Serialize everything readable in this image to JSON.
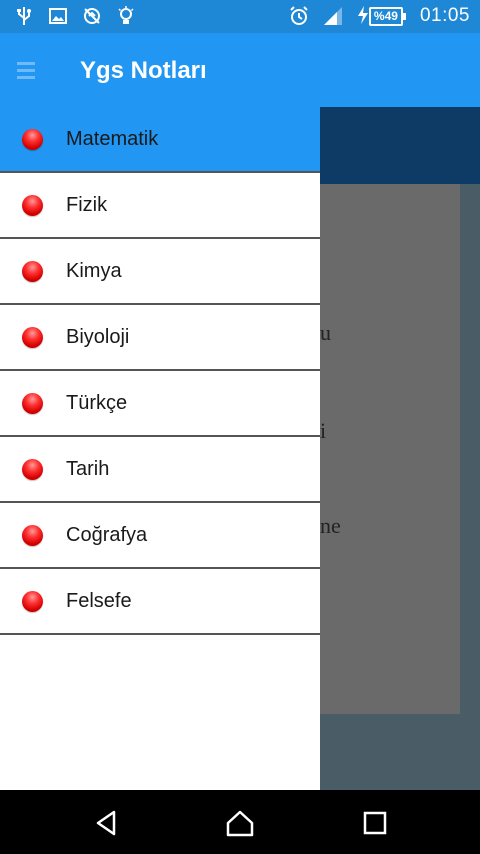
{
  "status_bar": {
    "time": "01:05",
    "battery": "%49",
    "icons": [
      "usb-icon",
      "image-icon",
      "no-sync-icon",
      "bulb-icon",
      "alarm-icon",
      "signal-icon",
      "charging-icon",
      "battery-icon"
    ]
  },
  "app_bar": {
    "title": "Ygs Notları"
  },
  "drawer": {
    "items": [
      {
        "label": "Matematik"
      },
      {
        "label": "Fizik"
      },
      {
        "label": "Kimya"
      },
      {
        "label": "Biyoloji"
      },
      {
        "label": "Türkçe"
      },
      {
        "label": "Tarih"
      },
      {
        "label": "Coğrafya"
      },
      {
        "label": "Felsefe"
      }
    ]
  },
  "background": {
    "fragments": [
      "u",
      "i",
      "ne"
    ]
  },
  "colors": {
    "primary": "#2196f3",
    "status_bar": "#1e88d6",
    "dot": "#ff2020"
  }
}
